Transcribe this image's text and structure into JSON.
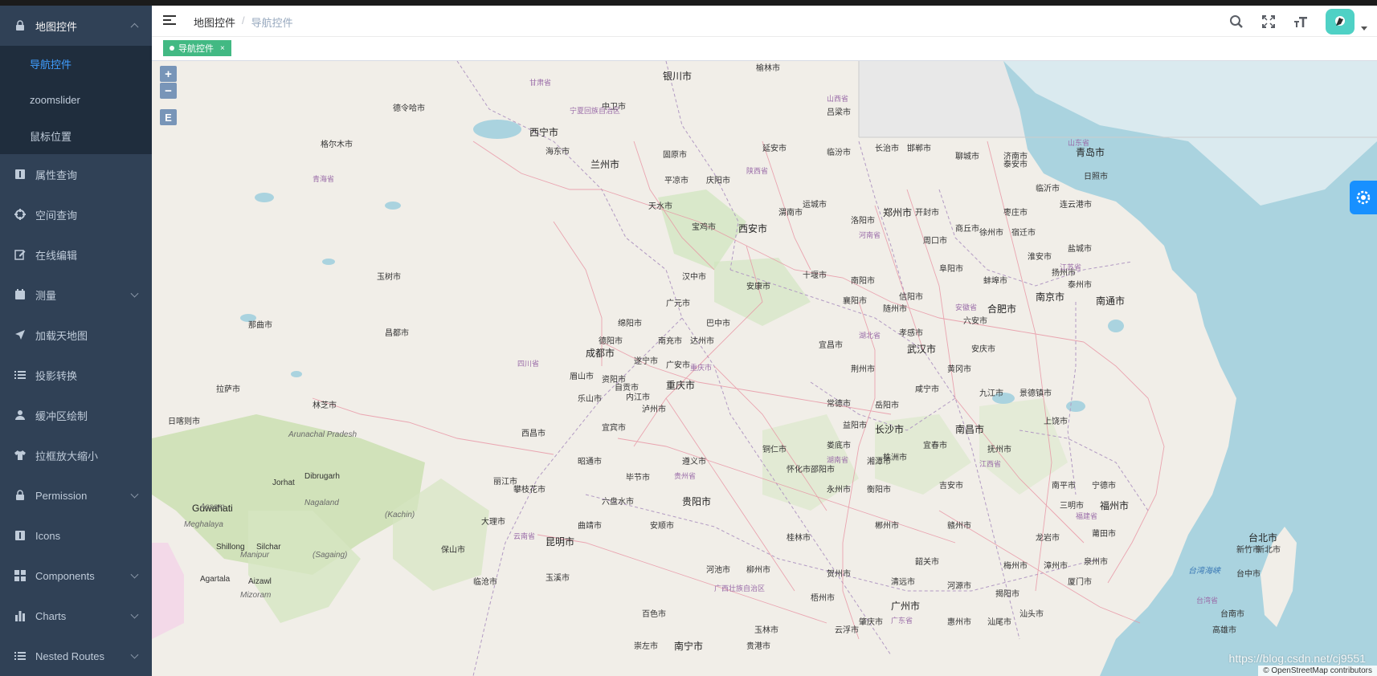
{
  "sidebar": {
    "items": [
      {
        "label": "地图控件",
        "icon": "lock-icon",
        "open": true,
        "children": [
          {
            "label": "导航控件",
            "active": true
          },
          {
            "label": "zoomslider",
            "active": false
          },
          {
            "label": "鼠标位置",
            "active": false
          }
        ]
      },
      {
        "label": "属性查询",
        "icon": "info-icon"
      },
      {
        "label": "空间查询",
        "icon": "crosshair-icon"
      },
      {
        "label": "在线编辑",
        "icon": "edit-icon"
      },
      {
        "label": "测量",
        "icon": "ruler-icon",
        "hasChildren": true
      },
      {
        "label": "加载天地图",
        "icon": "send-icon"
      },
      {
        "label": "投影转换",
        "icon": "list-icon"
      },
      {
        "label": "缓冲区绘制",
        "icon": "user-icon"
      },
      {
        "label": "拉框放大缩小",
        "icon": "shirt-icon"
      },
      {
        "label": "Permission",
        "icon": "lock-icon",
        "hasChildren": true
      },
      {
        "label": "Icons",
        "icon": "info-icon"
      },
      {
        "label": "Components",
        "icon": "grid-icon",
        "hasChildren": true
      },
      {
        "label": "Charts",
        "icon": "bar-chart-icon",
        "hasChildren": true
      },
      {
        "label": "Nested Routes",
        "icon": "list-icon",
        "hasChildren": true
      }
    ]
  },
  "header": {
    "breadcrumb": [
      "地图控件",
      "导航控件"
    ]
  },
  "tags": {
    "active_tag": "导航控件",
    "close": "×"
  },
  "map": {
    "zoom_in": "+",
    "zoom_out": "−",
    "extent_button": "E",
    "attribution": "© OpenStreetMap contributors",
    "watermark": "https://blog.csdn.net/cj9551",
    "places": [
      {
        "name": "银川市",
        "big": true
      },
      {
        "name": "中卫市"
      },
      {
        "name": "兰州市",
        "big": true
      },
      {
        "name": "西宁市",
        "big": true
      },
      {
        "name": "海东市"
      },
      {
        "name": "固原市"
      },
      {
        "name": "平凉市"
      },
      {
        "name": "庆阳市"
      },
      {
        "name": "延安市"
      },
      {
        "name": "榆林市"
      },
      {
        "name": "吕梁市"
      },
      {
        "name": "临汾市"
      },
      {
        "name": "长治市"
      },
      {
        "name": "邯郸市"
      },
      {
        "name": "聊城市"
      },
      {
        "name": "济南市"
      },
      {
        "name": "泰安市"
      },
      {
        "name": "青岛市",
        "big": true
      },
      {
        "name": "日照市"
      },
      {
        "name": "临沂市"
      },
      {
        "name": "枣庄市"
      },
      {
        "name": "连云港市"
      },
      {
        "name": "盐城市"
      },
      {
        "name": "宿迁市"
      },
      {
        "name": "徐州市"
      },
      {
        "name": "淮安市"
      },
      {
        "name": "泰州市"
      },
      {
        "name": "南通市",
        "big": true
      },
      {
        "name": "南京市",
        "big": true
      },
      {
        "name": "扬州市"
      },
      {
        "name": "天水市"
      },
      {
        "name": "宝鸡市"
      },
      {
        "name": "西安市",
        "big": true
      },
      {
        "name": "渭南市"
      },
      {
        "name": "运城市"
      },
      {
        "name": "洛阳市"
      },
      {
        "name": "郑州市",
        "big": true
      },
      {
        "name": "开封市"
      },
      {
        "name": "商丘市"
      },
      {
        "name": "周口市"
      },
      {
        "name": "阜阳市"
      },
      {
        "name": "蚌埠市"
      },
      {
        "name": "合肥市",
        "big": true
      },
      {
        "name": "六安市"
      },
      {
        "name": "安庆市"
      },
      {
        "name": "汉中市"
      },
      {
        "name": "安康市"
      },
      {
        "name": "十堰市"
      },
      {
        "name": "南阳市"
      },
      {
        "name": "信阳市"
      },
      {
        "name": "襄阳市"
      },
      {
        "name": "随州市"
      },
      {
        "name": "孝感市"
      },
      {
        "name": "武汉市",
        "big": true
      },
      {
        "name": "黄冈市"
      },
      {
        "name": "九江市"
      },
      {
        "name": "景德镇市"
      },
      {
        "name": "上饶市"
      },
      {
        "name": "宜昌市"
      },
      {
        "name": "荆州市"
      },
      {
        "name": "岳阳市"
      },
      {
        "name": "咸宁市"
      },
      {
        "name": "常德市"
      },
      {
        "name": "益阳市"
      },
      {
        "name": "长沙市",
        "big": true
      },
      {
        "name": "南昌市",
        "big": true
      },
      {
        "name": "宜春市"
      },
      {
        "name": "株洲市"
      },
      {
        "name": "湘潭市"
      },
      {
        "name": "娄底市"
      },
      {
        "name": "衡阳市"
      },
      {
        "name": "永州市"
      },
      {
        "name": "郴州市"
      },
      {
        "name": "赣州市"
      },
      {
        "name": "吉安市"
      },
      {
        "name": "抚州市"
      },
      {
        "name": "三明市"
      },
      {
        "name": "福州市",
        "big": true
      },
      {
        "name": "宁德市"
      },
      {
        "name": "南平市"
      },
      {
        "name": "莆田市"
      },
      {
        "name": "泉州市"
      },
      {
        "name": "漳州市"
      },
      {
        "name": "厦门市"
      },
      {
        "name": "龙岩市"
      },
      {
        "name": "梅州市"
      },
      {
        "name": "韶关市"
      },
      {
        "name": "清远市"
      },
      {
        "name": "广州市",
        "big": true
      },
      {
        "name": "河源市"
      },
      {
        "name": "揭阳市"
      },
      {
        "name": "汕头市"
      },
      {
        "name": "汕尾市"
      },
      {
        "name": "惠州市"
      },
      {
        "name": "肇庆市"
      },
      {
        "name": "云浮市"
      },
      {
        "name": "梧州市"
      },
      {
        "name": "贺州市"
      },
      {
        "name": "桂林市"
      },
      {
        "name": "柳州市"
      },
      {
        "name": "河池市"
      },
      {
        "name": "百色市"
      },
      {
        "name": "玉林市"
      },
      {
        "name": "贵港市"
      },
      {
        "name": "南宁市",
        "big": true
      },
      {
        "name": "崇左市"
      },
      {
        "name": "广元市"
      },
      {
        "name": "巴中市"
      },
      {
        "name": "绵阳市"
      },
      {
        "name": "德阳市"
      },
      {
        "name": "成都市",
        "big": true
      },
      {
        "name": "遂宁市"
      },
      {
        "name": "南充市"
      },
      {
        "name": "达州市"
      },
      {
        "name": "广安市"
      },
      {
        "name": "资阳市"
      },
      {
        "name": "内江市"
      },
      {
        "name": "重庆市",
        "big": true
      },
      {
        "name": "眉山市"
      },
      {
        "name": "乐山市"
      },
      {
        "name": "自贡市"
      },
      {
        "name": "泸州市"
      },
      {
        "name": "宜宾市"
      },
      {
        "name": "昭通市"
      },
      {
        "name": "遵义市"
      },
      {
        "name": "铜仁市"
      },
      {
        "name": "怀化市"
      },
      {
        "name": "邵阳市"
      },
      {
        "name": "贵阳市",
        "big": true
      },
      {
        "name": "安顺市"
      },
      {
        "name": "六盘水市"
      },
      {
        "name": "毕节市"
      },
      {
        "name": "曲靖市"
      },
      {
        "name": "昆明市",
        "big": true
      },
      {
        "name": "玉溪市"
      },
      {
        "name": "丽江市"
      },
      {
        "name": "大理市"
      },
      {
        "name": "保山市"
      },
      {
        "name": "临沧市"
      },
      {
        "name": "攀枝花市"
      },
      {
        "name": "西昌市"
      },
      {
        "name": "拉萨市"
      },
      {
        "name": "那曲市"
      },
      {
        "name": "昌都市"
      },
      {
        "name": "林芝市"
      },
      {
        "name": "日喀则市"
      },
      {
        "name": "玉树市"
      },
      {
        "name": "格尔木市"
      },
      {
        "name": "德令哈市"
      },
      {
        "name": "台北市",
        "big": true
      },
      {
        "name": "新竹市"
      },
      {
        "name": "台中市"
      },
      {
        "name": "台南市"
      },
      {
        "name": "高雄市"
      },
      {
        "name": "新北市"
      },
      {
        "name": "Guwahati",
        "big": true
      },
      {
        "name": "Silchar"
      },
      {
        "name": "Dibrugarh"
      },
      {
        "name": "Jorhat"
      },
      {
        "name": "Agartala"
      },
      {
        "name": "Aizawl"
      },
      {
        "name": "Shillong"
      }
    ],
    "provinces": [
      "青海省",
      "甘肃省",
      "宁夏回族自治区",
      "陕西省",
      "山西省",
      "山东省",
      "河南省",
      "江苏省",
      "安徽省",
      "湖北省",
      "四川省",
      "重庆市",
      "湖南省",
      "江西省",
      "福建省",
      "贵州省",
      "广西壮族自治区",
      "广东省",
      "云南省",
      "台湾省"
    ],
    "english_labels": [
      "Arunachal Pradesh",
      "Assam",
      "Nagaland",
      "Meghalaya",
      "Manipur",
      "Mizoram",
      "(Kachin)",
      "(Sagaing)"
    ],
    "seas": [
      "台湾海峡"
    ]
  }
}
